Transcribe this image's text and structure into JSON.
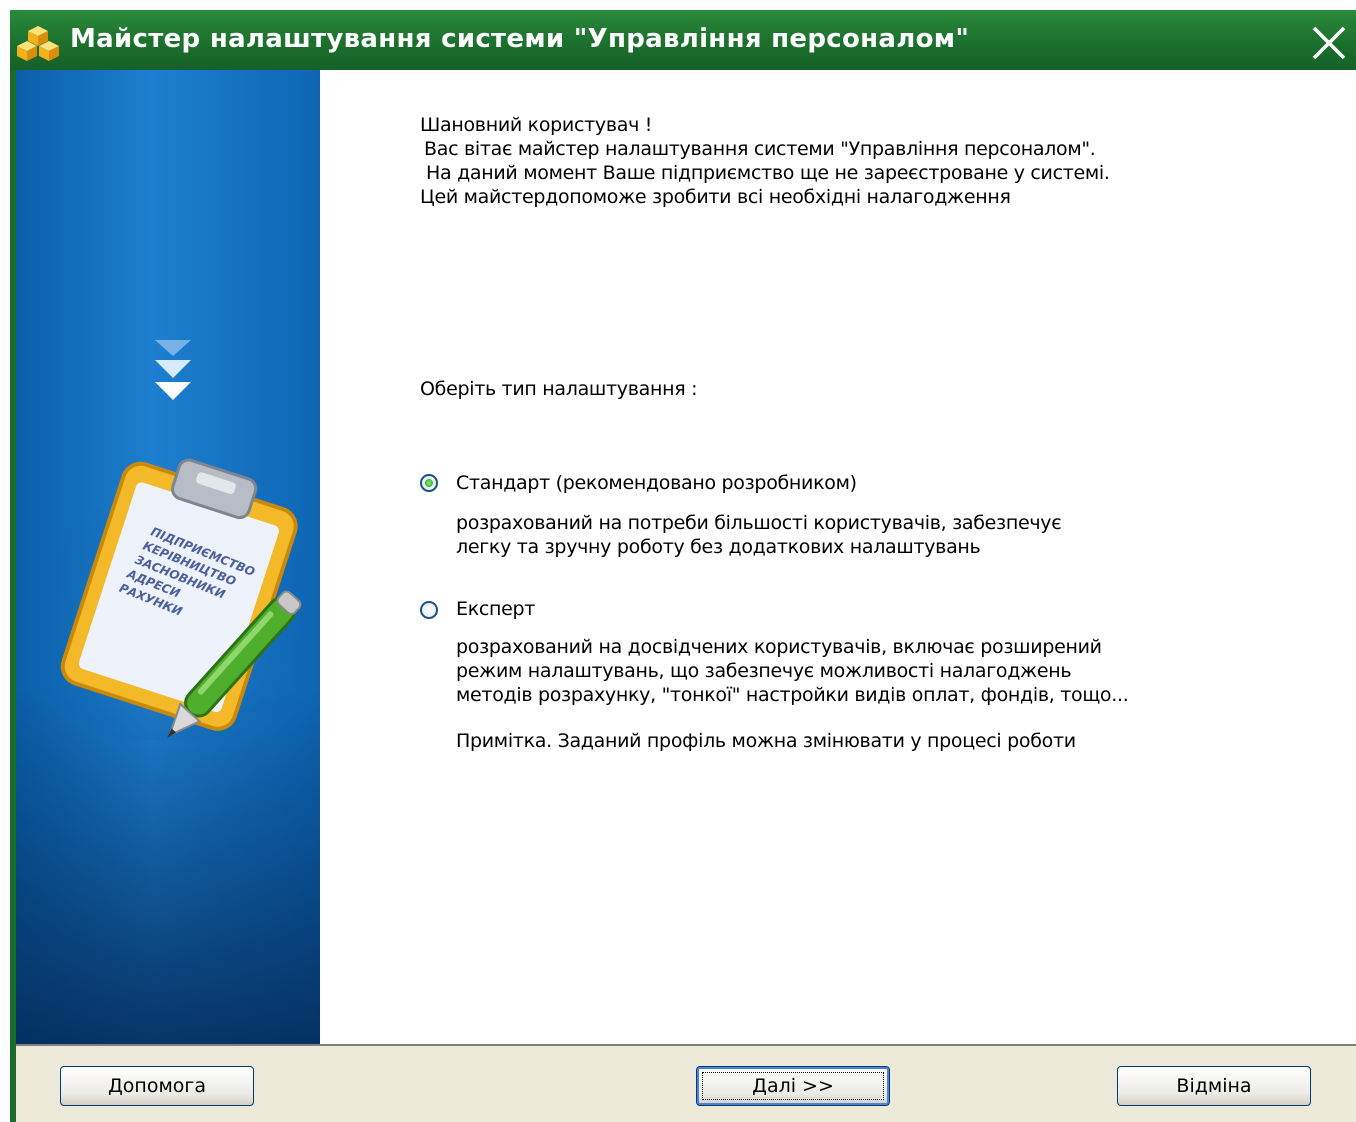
{
  "window": {
    "title": "Майстер налаштування системи \"Управління персоналом\""
  },
  "side_panel": {
    "clipboard_lines": [
      "ПІДПРИЄМСТВО",
      "КЕРІВНИЦТВО",
      "ЗАСНОВНИКИ",
      "АДРЕСИ",
      "РАХУНКИ"
    ]
  },
  "intro": {
    "line1": "Шановний користувач !",
    "line2": "Вас вітає майстер налаштування системи \"Управління персоналом\".",
    "line3": "На даний момент Ваше підприємство ще не зареєстроване у системі.",
    "line4": "Цей майстердопоможе зробити всі необхідні налагодження"
  },
  "setup_type": {
    "prompt": "Оберіть тип налаштування :",
    "options": [
      {
        "label": "Стандарт (рекомендовано розробником)",
        "checked": true,
        "desc": [
          "розрахований на потреби більшості користувачів, забезпечує",
          "легку та зручну роботу без додаткових налаштувань"
        ]
      },
      {
        "label": "Експерт",
        "checked": false,
        "desc": [
          "розрахований на досвідчених користувачів, включає розширений",
          "режим налаштувань, що забезпечує можливості налагоджень",
          "методів розрахунку, \"тонкої\" настройки видів оплат, фондів, тощо..."
        ]
      }
    ],
    "note": "Примітка. Заданий профіль можна змінювати у процесі роботи"
  },
  "footer": {
    "help_label": "Допомога",
    "next_label": "Далі >>",
    "cancel_label": "Відміна"
  },
  "colors": {
    "titlebar": "#1b6e2c",
    "side_panel": "#1d7fcf",
    "footer": "#ece9d8"
  }
}
